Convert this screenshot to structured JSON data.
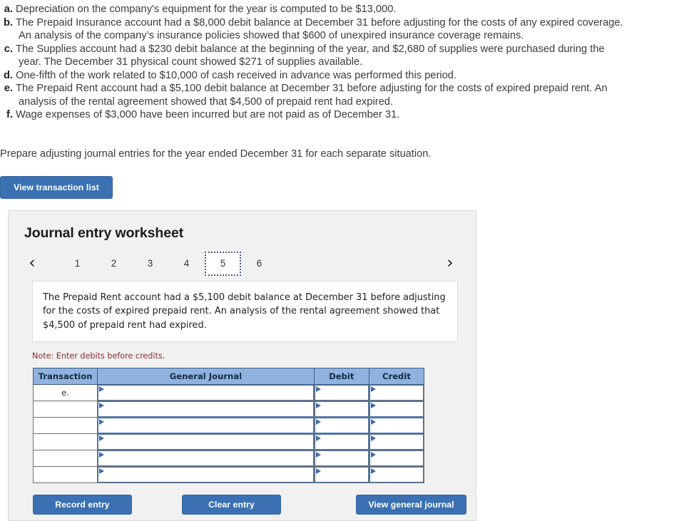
{
  "problem": {
    "items": [
      {
        "letter": "a.",
        "lines": [
          "Depreciation on the company's equipment for the year is computed to be $13,000."
        ]
      },
      {
        "letter": "b.",
        "lines": [
          "The Prepaid Insurance account had a $8,000 debit balance at December 31 before adjusting for the costs of any expired coverage.",
          "An analysis of the company’s insurance policies showed that $600 of unexpired insurance coverage remains."
        ]
      },
      {
        "letter": "c.",
        "lines": [
          "The Supplies account had a $230 debit balance at the beginning of the year, and $2,680 of supplies were purchased during the",
          "year. The December 31 physical count showed $271 of supplies available."
        ]
      },
      {
        "letter": "d.",
        "lines": [
          "One-fifth of the work related to $10,000 of cash received in advance was performed this period."
        ]
      },
      {
        "letter": "e.",
        "lines": [
          "The Prepaid Rent account had a $5,100 debit balance at December 31 before adjusting for the costs of expired prepaid rent. An",
          "analysis of the rental agreement showed that $4,500 of prepaid rent had expired."
        ]
      },
      {
        "letter": "f.",
        "lines": [
          "Wage expenses of $3,000 have been incurred but are not paid as of December 31."
        ]
      }
    ],
    "instruction": "Prepare adjusting journal entries for the year ended December 31 for each separate situation."
  },
  "buttons": {
    "view_transaction_list": "View transaction list",
    "record_entry": "Record entry",
    "clear_entry": "Clear entry",
    "view_general_journal": "View general journal"
  },
  "worksheet": {
    "title": "Journal entry worksheet",
    "pager": {
      "prev_icon": "chevron-left-icon",
      "next_icon": "chevron-right-icon",
      "prev_glyph": "‹",
      "next_glyph": "›",
      "tabs": [
        "1",
        "2",
        "3",
        "4",
        "5",
        "6"
      ],
      "active_tab": "5"
    },
    "situation_text": "The Prepaid Rent account had a $5,100 debit balance at December 31 before adjusting for the costs of expired prepaid rent. An analysis of the rental agreement showed that $4,500 of prepaid rent had expired.",
    "note": "Note: Enter debits before credits.",
    "table": {
      "headers": [
        "Transaction",
        "General Journal",
        "Debit",
        "Credit"
      ],
      "rows": [
        {
          "transaction": "e.",
          "general_journal": "",
          "debit": "",
          "credit": ""
        },
        {
          "transaction": "",
          "general_journal": "",
          "debit": "",
          "credit": ""
        },
        {
          "transaction": "",
          "general_journal": "",
          "debit": "",
          "credit": ""
        },
        {
          "transaction": "",
          "general_journal": "",
          "debit": "",
          "credit": ""
        },
        {
          "transaction": "",
          "general_journal": "",
          "debit": "",
          "credit": ""
        },
        {
          "transaction": "",
          "general_journal": "",
          "debit": "",
          "credit": ""
        }
      ]
    }
  },
  "colors": {
    "button_blue": "#3b71b3",
    "table_header_blue": "#8fb2de",
    "note_red": "#8a2f2f",
    "panel_gray": "#f1f1f1",
    "input_border_blue": "#4a74a8"
  }
}
